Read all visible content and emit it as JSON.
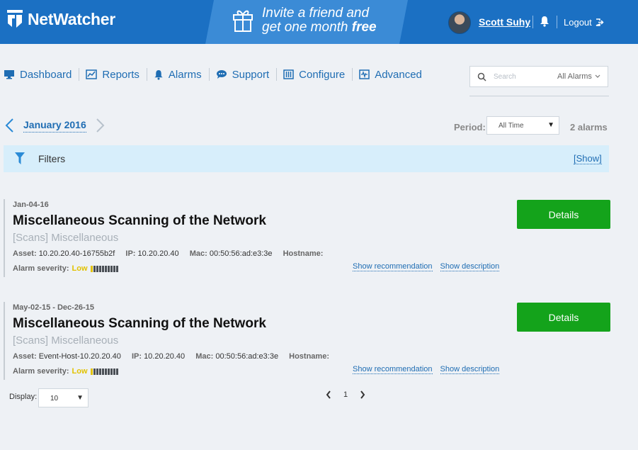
{
  "header": {
    "logo_text": "NetWatcher",
    "promo_line1": "Invite a friend and",
    "promo_line2": "get one month",
    "promo_highlight": "free",
    "user_name": "Scott Suhy",
    "logout_label": "Logout"
  },
  "nav": {
    "items": [
      {
        "label": "Dashboard",
        "icon": "monitor-icon"
      },
      {
        "label": "Reports",
        "icon": "chart-icon"
      },
      {
        "label": "Alarms",
        "icon": "bell-icon"
      },
      {
        "label": "Support",
        "icon": "chat-icon"
      },
      {
        "label": "Configure",
        "icon": "sliders-icon"
      },
      {
        "label": "Advanced",
        "icon": "waveform-icon"
      }
    ],
    "search_placeholder": "Search",
    "search_scope": "All Alarms"
  },
  "month": {
    "label": "January 2016",
    "period_label": "Period:",
    "period_value": "All Time",
    "alarm_count": "2 alarms"
  },
  "filters": {
    "label": "Filters",
    "show_label": "[Show]"
  },
  "alarms": [
    {
      "date": "Jan-04-16",
      "title": "Miscellaneous Scanning of the Network",
      "subtitle": "[Scans] Miscellaneous",
      "asset_label": "Asset:",
      "asset": "10.20.20.40-16755b2f",
      "ip_label": "IP:",
      "ip": "10.20.20.40",
      "mac_label": "Mac:",
      "mac": "00:50:56:ad:e3:3e",
      "hostname_label": "Hostname:",
      "hostname": "",
      "severity_label": "Alarm severity:",
      "severity": "Low",
      "severity_level": 1,
      "severity_max": 10,
      "show_recommendation": "Show recommendation",
      "show_description": "Show description",
      "details_label": "Details"
    },
    {
      "date": "May-02-15 - Dec-26-15",
      "title": "Miscellaneous Scanning of the Network",
      "subtitle": "[Scans] Miscellaneous",
      "asset_label": "Asset:",
      "asset": "Event-Host-10.20.20.40",
      "ip_label": "IP:",
      "ip": "10.20.20.40",
      "mac_label": "Mac:",
      "mac": "00:50:56:ad:e3:3e",
      "hostname_label": "Hostname:",
      "hostname": "",
      "severity_label": "Alarm severity:",
      "severity": "Low",
      "severity_level": 1,
      "severity_max": 10,
      "show_recommendation": "Show recommendation",
      "show_description": "Show description",
      "details_label": "Details"
    }
  ],
  "footer": {
    "display_label": "Display:",
    "display_value": "10",
    "page": "1"
  },
  "colors": {
    "brand_blue": "#1b70c3",
    "link_blue": "#1f6db3",
    "details_green": "#14a31b",
    "severity_low": "#e2c200",
    "filter_bg": "#d7eefb"
  }
}
